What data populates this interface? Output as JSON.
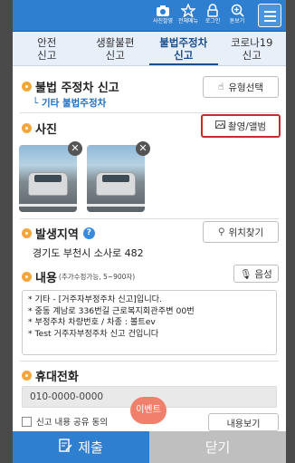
{
  "header": {
    "icons": [
      {
        "label": "사진촬영",
        "icon": "camera-icon"
      },
      {
        "label": "전체메뉴",
        "icon": "star-icon"
      },
      {
        "label": "로그인",
        "icon": "lock-icon"
      },
      {
        "label": "돋보기",
        "icon": "zoom-icon"
      }
    ],
    "menu_icon": "hamburger-icon"
  },
  "tabs": [
    {
      "line1": "안전",
      "line2": "신고",
      "active": false
    },
    {
      "line1": "생활불편",
      "line2": "신고",
      "active": false
    },
    {
      "line1": "불법주정차",
      "line2": "신고",
      "active": true
    },
    {
      "line1": "코로나19",
      "line2": "신고",
      "active": false
    }
  ],
  "report": {
    "title": "불법 주정차 신고",
    "subtype": "기타 불법주정차",
    "type_button": "유형선택"
  },
  "photo": {
    "title": "사진",
    "button": "촬영/앨범"
  },
  "location": {
    "title": "발생지역",
    "button": "위치찾기",
    "address": "경기도 부천시 소사로 482"
  },
  "content": {
    "title": "내용",
    "limit_note": "(추가수정가능, 5~900자)",
    "voice_button": "음성",
    "lines": [
      "* 기타 - [거주자부정주차 신고]입니다.",
      "* 중동 계남로 336번길 근로복지회관주변 00번",
      "* 부정주차 차량번호 /  차종 : 볼트ev",
      "* Test 거주자부정주차 신고 건입니다"
    ]
  },
  "phone": {
    "title": "휴대전화",
    "value": "010-0000-0000"
  },
  "share": {
    "label": "신고 내용 공유 동의",
    "view_button": "내용보기"
  },
  "event_badge": "이벤트",
  "bottom": {
    "submit": "제출",
    "close": "닫기"
  },
  "colors": {
    "primary": "#2e7fd0",
    "accent_dot": "#f4a63d",
    "highlight_border": "#cc2a2a",
    "event": "#f07f6b"
  }
}
